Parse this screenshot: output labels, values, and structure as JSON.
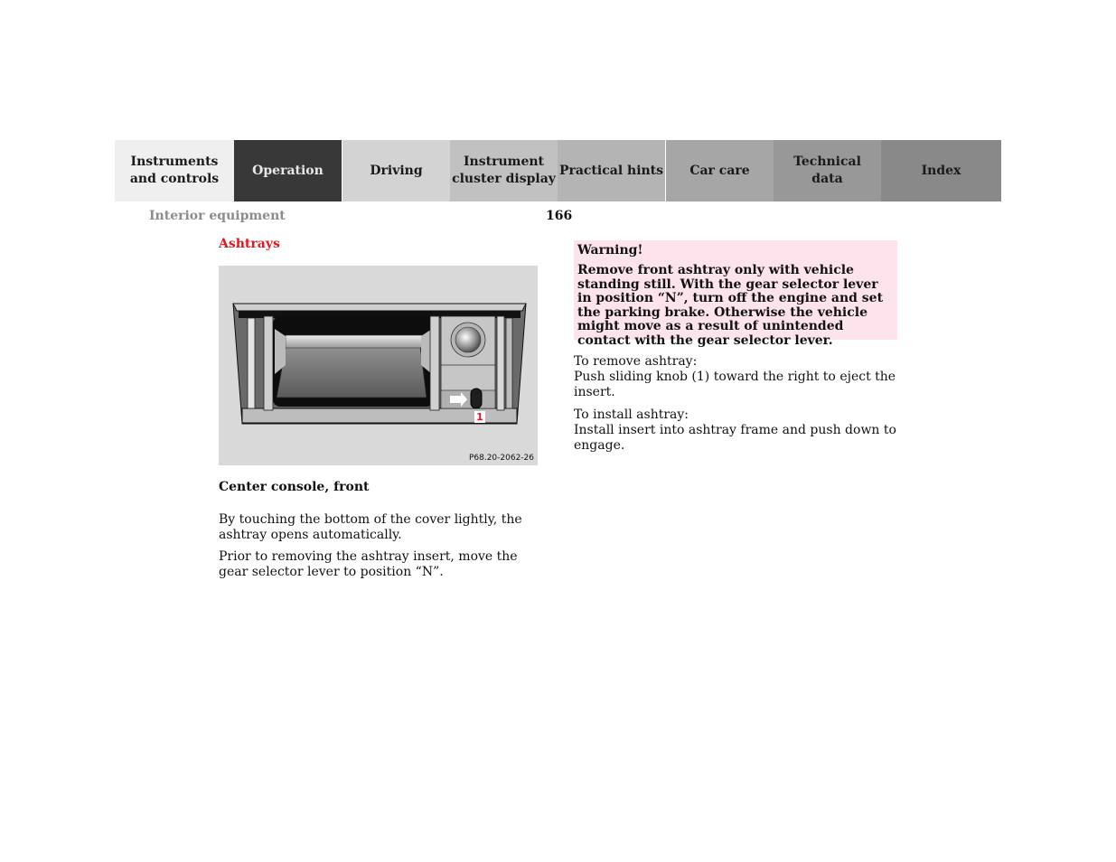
{
  "nav": {
    "tabs": [
      {
        "line1": "Instruments",
        "line2": "and controls",
        "active": false
      },
      {
        "line1": "Operation",
        "line2": "",
        "active": true
      },
      {
        "line1": "Driving",
        "line2": "",
        "active": false
      },
      {
        "line1": "Instrument",
        "line2": "cluster display",
        "active": false
      },
      {
        "line1": "Practical hints",
        "line2": "",
        "active": false
      },
      {
        "line1": "Car care",
        "line2": "",
        "active": false
      },
      {
        "line1": "Technical",
        "line2": "data",
        "active": false
      },
      {
        "line1": "Index",
        "line2": "",
        "active": false
      }
    ]
  },
  "header": {
    "section": "Interior equipment",
    "page_number": "166"
  },
  "content": {
    "heading": "Ashtrays",
    "heading_color": "#e8141c",
    "figure": {
      "code": "P68.20-2062-26",
      "callout": "1",
      "description": "Front ashtray in center console with cigar lighter and sliding knob"
    },
    "caption": "Center console, front",
    "paragraphs": [
      "By touching the bottom of the cover lightly, the ashtray opens automatically.",
      "Prior to removing the ashtray insert, move the gear selector lever to position “N”."
    ],
    "warning": {
      "title": "Warning!",
      "body": "Remove front ashtray only with vehicle standing still. With the gear selector lever in position “N”, turn off the engine and set the parking brake. Otherwise the vehicle might move as a result of unintended contact with the gear selector lever.",
      "background": "#fde4ec"
    },
    "remove": {
      "title": "To remove ashtray:",
      "text": "Push sliding knob (1) toward the right to eject the insert."
    },
    "install": {
      "title": "To install ashtray:",
      "text": "Install insert into ashtray frame and push down to engage."
    }
  }
}
